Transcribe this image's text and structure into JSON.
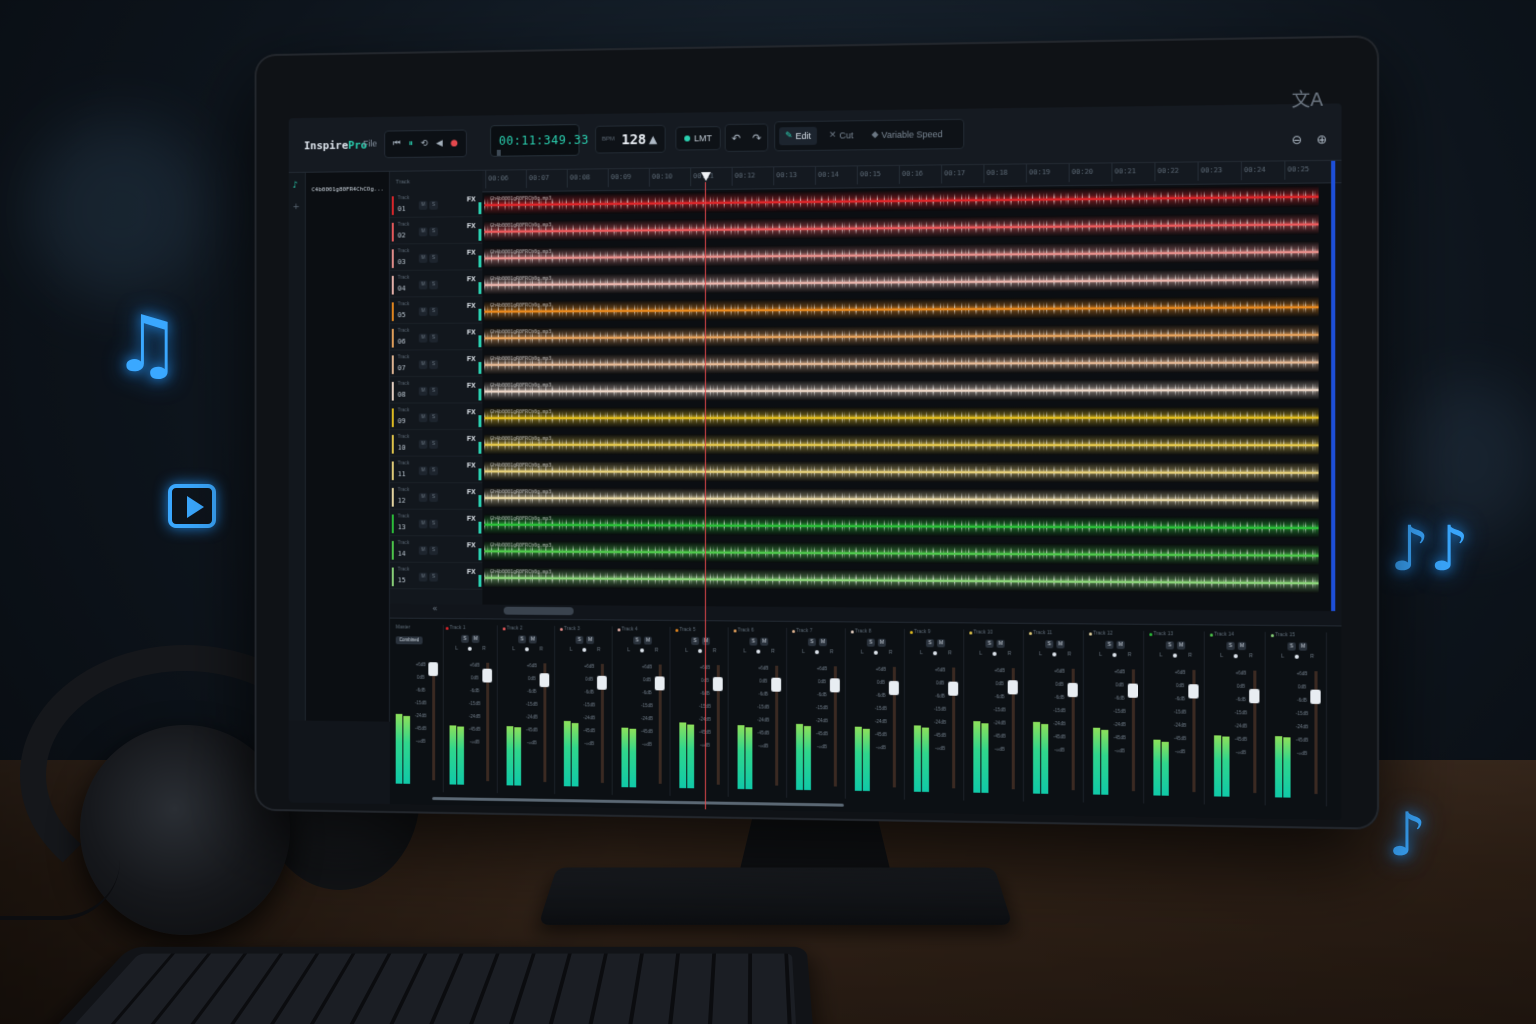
{
  "app": {
    "brand_main": "Inspire",
    "brand_accent": "Pro",
    "menu_file": "File",
    "translate_icon": "translate-icon"
  },
  "toolbar": {
    "timecode": "00:11:349.33",
    "bpm_label": "BPM",
    "bpm": "128",
    "limiter_label": "LMT",
    "edit_label": "Edit",
    "cut_label": "Cut",
    "variable_speed_label": "Variable Speed"
  },
  "ruler": {
    "marks": [
      "00:06",
      "00:07",
      "00:08",
      "00:09",
      "00:10",
      "00:11",
      "00:12",
      "00:13",
      "00:14",
      "00:15",
      "00:16",
      "00:17",
      "00:18",
      "00:19",
      "00:20",
      "00:21",
      "00:22",
      "00:23",
      "00:24",
      "00:25"
    ]
  },
  "files": {
    "name": "C4b0001g80FR4ChCOg..."
  },
  "track_headers": {
    "title": "Track",
    "m_label": "M",
    "s_label": "S",
    "fx_label": "FX"
  },
  "tracks": [
    {
      "label": "Track",
      "num": "01",
      "color": "#e0262a",
      "clip": "Gh4b0001gR0FRCh0g.mp3"
    },
    {
      "label": "Track",
      "num": "02",
      "color": "#ec5a5c",
      "clip": "Gh4b0001gR0FRCh0g.mp3"
    },
    {
      "label": "Track",
      "num": "03",
      "color": "#e9908c",
      "clip": "Gh4b0001gR0FRCh0g.mp3"
    },
    {
      "label": "Track",
      "num": "04",
      "color": "#eab5ac",
      "clip": "Gh4b0001gR0FRCh0g.mp3"
    },
    {
      "label": "Track",
      "num": "05",
      "color": "#e8891e",
      "clip": "Gh4b0001gR0FRCh0g.mp3"
    },
    {
      "label": "Track",
      "num": "06",
      "color": "#e8a35c",
      "clip": "Gh4b0001gR0FRCh0g.mp3"
    },
    {
      "label": "Track",
      "num": "07",
      "color": "#e6b994",
      "clip": "Gh4b0001gR0FRCh0g.mp3"
    },
    {
      "label": "Track",
      "num": "08",
      "color": "#ecd6c6",
      "clip": "Gh4b0001gR0FRCh0g.mp3"
    },
    {
      "label": "Track",
      "num": "09",
      "color": "#e5c020",
      "clip": "Gh4b0001gR0FRCh0g.mp3"
    },
    {
      "label": "Track",
      "num": "10",
      "color": "#e6c94c",
      "clip": "Gh4b0001gR0FRCh0g.mp3"
    },
    {
      "label": "Track",
      "num": "11",
      "color": "#e6d07a",
      "clip": "Gh4b0001gR0FRCh0g.mp3"
    },
    {
      "label": "Track",
      "num": "12",
      "color": "#ead9a4",
      "clip": "Gh4b0001gR0FRCh0g.mp3"
    },
    {
      "label": "Track",
      "num": "13",
      "color": "#2cc23a",
      "clip": "Gh4b0001gR0FRCh0g.mp3"
    },
    {
      "label": "Track",
      "num": "14",
      "color": "#4fca4c",
      "clip": "Gh4b0001gR0FRCh0g.mp3"
    },
    {
      "label": "Track",
      "num": "15",
      "color": "#8cd57a",
      "clip": "Gh4b0001gR0FRCh0g.mp3"
    }
  ],
  "mixer": {
    "master_name": "Master",
    "master_btn": "Combined",
    "s_label": "S",
    "m_label": "M",
    "l_label": "L",
    "r_label": "R",
    "db_scale": [
      "+6dB",
      "0dB",
      "-6dB",
      "-15dB",
      "-24dB",
      "-45dB",
      "-∞dB"
    ],
    "strips": [
      {
        "name": "Track 1",
        "dot": "#e0262a",
        "level": 0.55,
        "fader": 0.05
      },
      {
        "name": "Track 2",
        "dot": "#ec5a5c",
        "level": 0.55,
        "fader": 0.08
      },
      {
        "name": "Track 3",
        "dot": "#e9908c",
        "level": 0.6,
        "fader": 0.1
      },
      {
        "name": "Track 4",
        "dot": "#eab5ac",
        "level": 0.55,
        "fader": 0.1
      },
      {
        "name": "Track 5",
        "dot": "#e8891e",
        "level": 0.6,
        "fader": 0.1
      },
      {
        "name": "Track 6",
        "dot": "#e8a35c",
        "level": 0.58,
        "fader": 0.1
      },
      {
        "name": "Track 7",
        "dot": "#e6b994",
        "level": 0.6,
        "fader": 0.1
      },
      {
        "name": "Track 8",
        "dot": "#ecd6c6",
        "level": 0.58,
        "fader": 0.12
      },
      {
        "name": "Track 9",
        "dot": "#e5c020",
        "level": 0.6,
        "fader": 0.12
      },
      {
        "name": "Track 10",
        "dot": "#e6c94c",
        "level": 0.65,
        "fader": 0.1
      },
      {
        "name": "Track 11",
        "dot": "#e6d07a",
        "level": 0.65,
        "fader": 0.12
      },
      {
        "name": "Track 12",
        "dot": "#ead9a4",
        "level": 0.6,
        "fader": 0.12
      },
      {
        "name": "Track 13",
        "dot": "#2cc23a",
        "level": 0.5,
        "fader": 0.12
      },
      {
        "name": "Track 14",
        "dot": "#4fca4c",
        "level": 0.55,
        "fader": 0.15
      },
      {
        "name": "Track 15",
        "dot": "#8cd57a",
        "level": 0.55,
        "fader": 0.15
      }
    ]
  },
  "colors": {
    "accent": "#2ad0b0",
    "playhead": "#e5484d",
    "glow_icons": "#3aa8ff"
  }
}
